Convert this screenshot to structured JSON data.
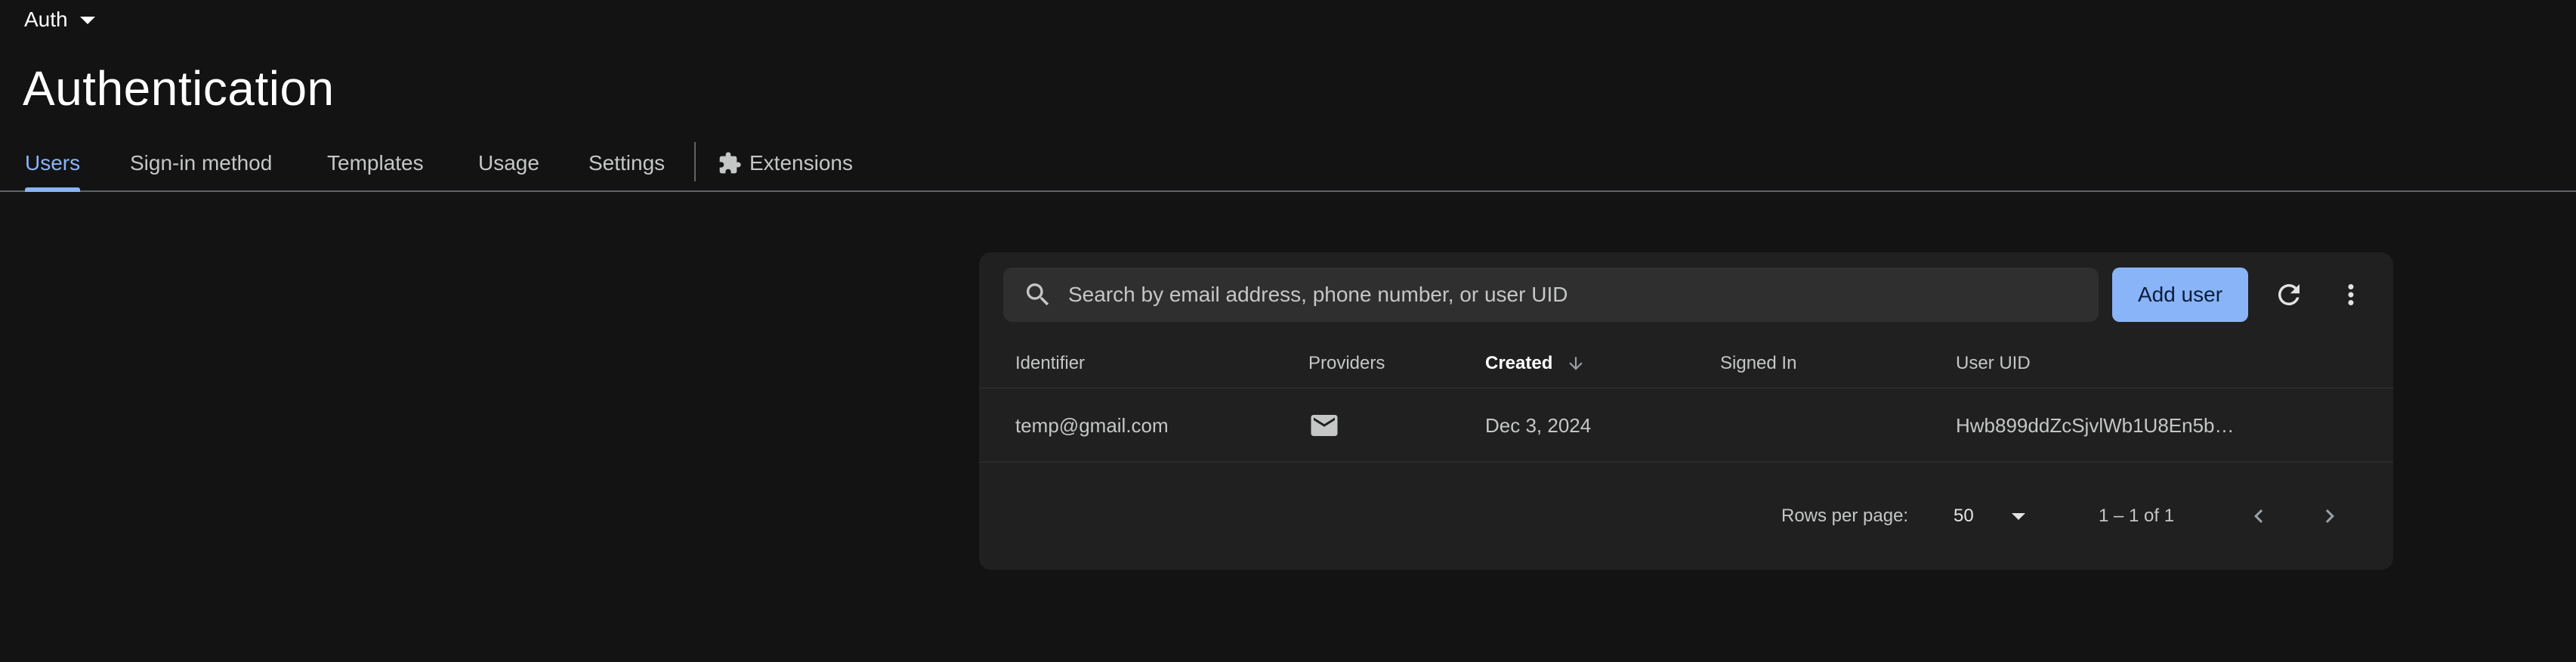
{
  "header": {
    "product": "Auth",
    "title": "Authentication"
  },
  "tabs": [
    {
      "label": "Users",
      "active": true
    },
    {
      "label": "Sign-in method"
    },
    {
      "label": "Templates"
    },
    {
      "label": "Usage"
    },
    {
      "label": "Settings"
    },
    {
      "label": "Extensions",
      "icon": "extension-icon"
    }
  ],
  "search": {
    "placeholder": "Search by email address, phone number, or user UID",
    "value": ""
  },
  "toolbar": {
    "add_user_label": "Add user",
    "refresh_icon": "refresh-icon",
    "more_icon": "more-vert-icon"
  },
  "table": {
    "columns": [
      "Identifier",
      "Providers",
      "Created",
      "Signed In",
      "User UID"
    ],
    "sorted_column": "Created",
    "rows": [
      {
        "identifier": "temp@gmail.com",
        "provider_icon": "email-icon",
        "created": "Dec 3, 2024",
        "signed_in": "",
        "uid": "Hwb899ddZcSjvlWb1U8En5b…"
      }
    ]
  },
  "pagination": {
    "rows_per_page_label": "Rows per page:",
    "rows_per_page": "50",
    "range": "1 – 1 of 1"
  },
  "colors": {
    "background": "#131313",
    "card": "#202020",
    "accent": "#8ab4f8"
  }
}
